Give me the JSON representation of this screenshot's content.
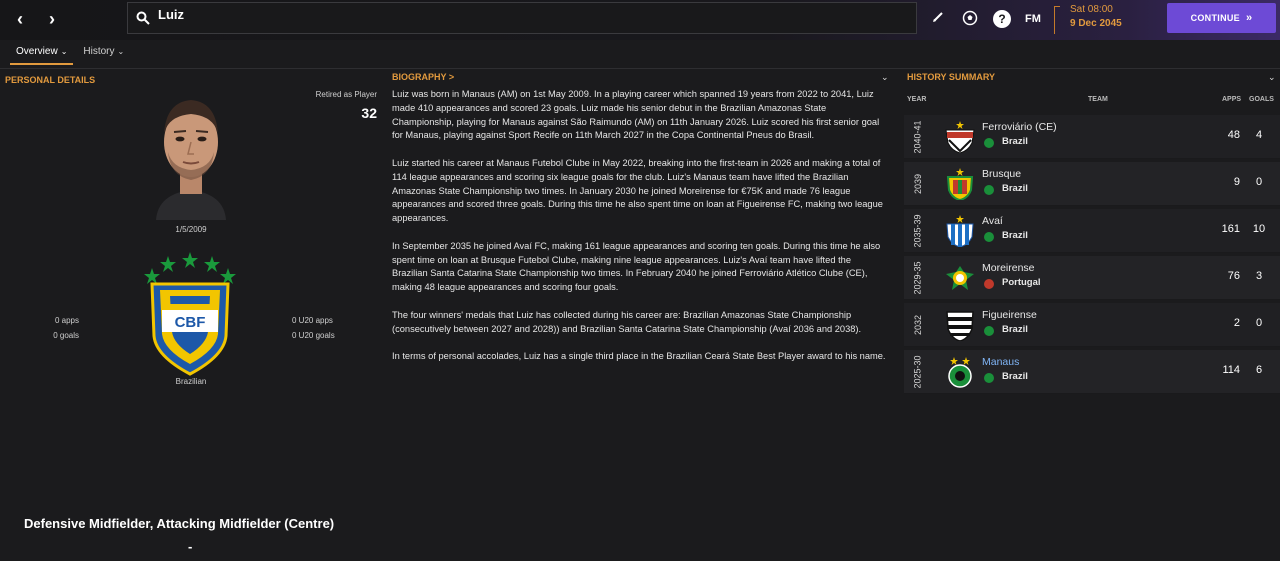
{
  "search": {
    "query": "Luiz"
  },
  "date": {
    "time": "Sat 08:00",
    "day": "9 Dec 2045"
  },
  "continue_label": "CONTINUE",
  "fm_label": "FM",
  "help_label": "?",
  "tabs": [
    {
      "label": "Overview",
      "active": true
    },
    {
      "label": "History",
      "active": false
    }
  ],
  "personal": {
    "title": "PERSONAL DETAILS",
    "retired_label": "Retired as Player",
    "retired_age": "32",
    "dob": "1/5/2009",
    "apps": "0 apps",
    "goals": "0 goals",
    "u20_apps": "0 U20 apps",
    "u20_goals": "0 U20 goals",
    "crest_text": "CBF",
    "nationality": "Brazilian",
    "position": "Defensive Midfielder, Attacking Midfielder (Centre)",
    "dash": "-"
  },
  "biography": {
    "title": "BIOGRAPHY >",
    "paragraphs": [
      "Luiz was born in Manaus (AM) on 1st May 2009. In a playing career which spanned 19 years from 2022 to 2041, Luiz made 410 appearances and scored 23 goals. Luiz made his senior debut in the Brazilian Amazonas State Championship, playing for Manaus against São Raimundo (AM) on 11th January 2026. Luiz scored his first senior goal for Manaus, playing against Sport Recife on 11th March 2027 in the Copa Continental Pneus do Brasil.",
      "Luiz started his career at Manaus Futebol Clube in May 2022, breaking into the first-team in 2026 and making a total of 114 league appearances and scoring six league goals for the club. Luiz's Manaus team have lifted the Brazilian Amazonas State Championship two times. In January 2030 he joined Moreirense for €75K and made 76 league appearances and scored three goals. During this time he also spent time on loan at Figueirense FC, making two league appearances.",
      "In September 2035 he joined Avaí FC, making 161 league appearances and scoring ten goals. During this time he also spent time on loan at Brusque Futebol Clube, making nine league appearances. Luiz's Avaí team have lifted the Brazilian Santa Catarina State Championship two times. In February 2040 he joined Ferroviário Atlético Clube (CE), making 48 league appearances and scoring four goals.",
      "The four winners' medals that Luiz has collected during his career are: Brazilian Amazonas State Championship (consecutively between 2027 and 2028)) and Brazilian Santa Catarina State Championship (Avaí 2036 and 2038).",
      "In terms of personal accolades, Luiz has a single third place in the Brazilian Ceará State Best Player award to his name."
    ]
  },
  "history": {
    "title": "HISTORY SUMMARY",
    "headers": {
      "year": "YEAR",
      "team": "TEAM",
      "apps": "APPS",
      "goals": "GOALS"
    },
    "rows": [
      {
        "year": "2040-41",
        "club": "Ferroviário (CE)",
        "country": "Brazil",
        "apps": "48",
        "goals": "4",
        "badge": "fac-badge",
        "link": false
      },
      {
        "year": "2039",
        "club": "Brusque",
        "country": "Brazil",
        "apps": "9",
        "goals": "0",
        "badge": "brusque-badge",
        "link": false
      },
      {
        "year": "2035-39",
        "club": "Avaí",
        "country": "Brazil",
        "apps": "161",
        "goals": "10",
        "badge": "avai-badge",
        "link": false
      },
      {
        "year": "2029-35",
        "club": "Moreirense",
        "country": "Portugal",
        "apps": "76",
        "goals": "3",
        "badge": "moreirense-badge",
        "link": false
      },
      {
        "year": "2032",
        "club": "Figueirense",
        "country": "Brazil",
        "apps": "2",
        "goals": "0",
        "badge": "figueirense-badge",
        "link": false
      },
      {
        "year": "2025-30",
        "club": "Manaus",
        "country": "Brazil",
        "apps": "114",
        "goals": "6",
        "badge": "manaus-badge",
        "link": true
      }
    ]
  },
  "colors": {
    "accent": "#e29a3e",
    "continue": "#6d4ad6",
    "link": "#7fb4f5",
    "brazil": "#1a8f3a",
    "portugal": "#c0392b"
  }
}
